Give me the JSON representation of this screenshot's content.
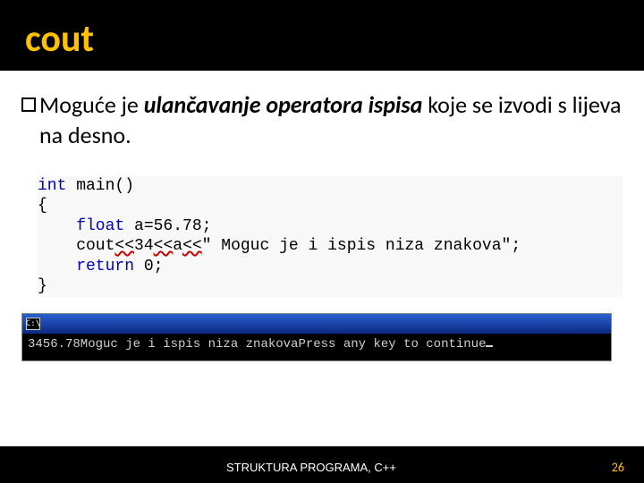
{
  "title": "cout",
  "bullet": {
    "prefix": "Moguće je ",
    "emph": "ulančavanje operatora ispisa",
    "suffix": " koje se izvodi s lijeva na desno."
  },
  "code": {
    "l1a": "int",
    "l1b": " main()",
    "l2": "{",
    "l3a": "    float",
    "l3b": " a=56.78;",
    "l4a": "    cout",
    "l4u1": "<<",
    "l4b": "34",
    "l4u2": "<<",
    "l4c": "a",
    "l4u3": "<<",
    "l4d": "\" Moguc je i ispis niza znakova\";",
    "l5a": "    return",
    "l5b": " 0;",
    "l6": "}"
  },
  "console": {
    "icon": "C:\\",
    "output": "3456.78Moguc je i ispis niza znakovaPress any key to continue"
  },
  "footer": {
    "text": "STRUKTURA PROGRAMA, C++",
    "page": "26"
  }
}
